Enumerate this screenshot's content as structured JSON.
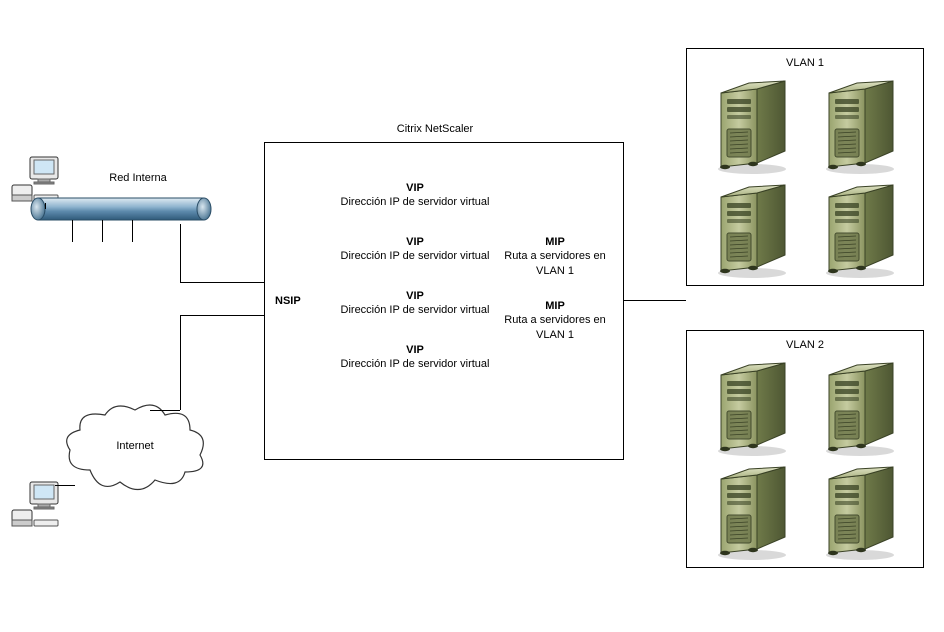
{
  "labels": {
    "internal_net": "Red Interna",
    "internet": "Internet",
    "main_title": "Citrix NetScaler",
    "nsip": "NSIP",
    "vlan1": "VLAN 1",
    "vlan2": "VLAN 2"
  },
  "vip": {
    "title": "VIP",
    "desc": "Dirección IP de servidor virtual"
  },
  "mip": {
    "title": "MIP",
    "desc": "Ruta a servidores en VLAN 1"
  }
}
